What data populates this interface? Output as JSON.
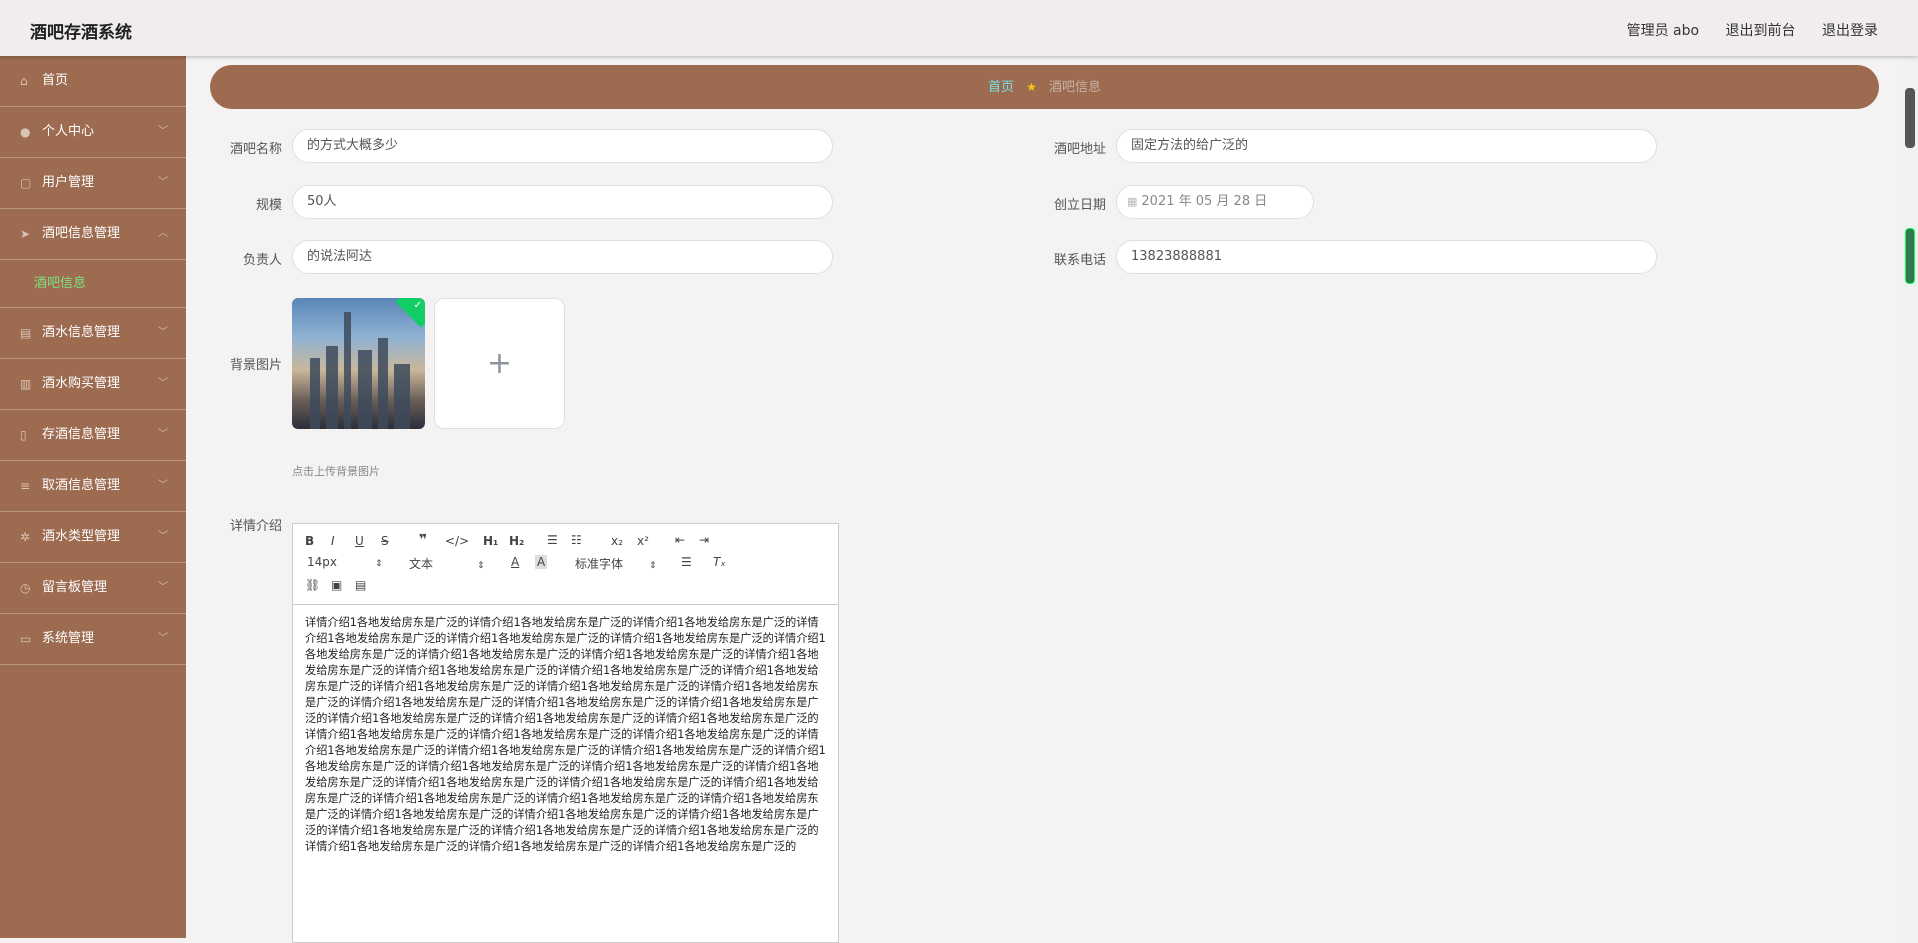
{
  "header": {
    "app_title": "酒吧存酒系统",
    "admin_label": "管理员 abo",
    "front_link": "退出到前台",
    "logout_link": "退出登录"
  },
  "sidebar": {
    "items": [
      {
        "label": "首页",
        "icon": "home-icon"
      },
      {
        "label": "个人中心",
        "icon": "user-icon"
      },
      {
        "label": "用户管理",
        "icon": "users-icon"
      },
      {
        "label": "酒吧信息管理",
        "icon": "location-icon",
        "sub": "酒吧信息"
      },
      {
        "label": "酒水信息管理",
        "icon": "drink-icon"
      },
      {
        "label": "酒水购买管理",
        "icon": "shop-icon"
      },
      {
        "label": "存酒信息管理",
        "icon": "bottle-icon"
      },
      {
        "label": "取酒信息管理",
        "icon": "sliders-icon"
      },
      {
        "label": "酒水类型管理",
        "icon": "category-icon"
      },
      {
        "label": "留言板管理",
        "icon": "clock-icon"
      },
      {
        "label": "系统管理",
        "icon": "system-icon"
      }
    ]
  },
  "breadcrumb": {
    "home": "首页",
    "current": "酒吧信息"
  },
  "form": {
    "bar_name_label": "酒吧名称",
    "bar_name_value": "的方式大概多少",
    "bar_address_label": "酒吧地址",
    "bar_address_value": "固定方法的给广泛的",
    "scale_label": "规模",
    "scale_value": "50人",
    "founded_label": "创立日期",
    "founded_value": "2021 年 05 月 28 日",
    "manager_label": "负责人",
    "manager_value": "的说法阿达",
    "phone_label": "联系电话",
    "phone_value": "13823888881",
    "bg_label": "背景图片",
    "upload_tip": "点击上传背景图片",
    "detail_label": "详情介绍"
  },
  "editor": {
    "font_size": "14px",
    "text_style": "文本",
    "font_family": "标准字体",
    "content": "详情介绍1各地发给房东是广泛的详情介绍1各地发给房东是广泛的详情介绍1各地发给房东是广泛的详情介绍1各地发给房东是广泛的详情介绍1各地发给房东是广泛的详情介绍1各地发给房东是广泛的详情介绍1各地发给房东是广泛的详情介绍1各地发给房东是广泛的详情介绍1各地发给房东是广泛的详情介绍1各地发给房东是广泛的详情介绍1各地发给房东是广泛的详情介绍1各地发给房东是广泛的详情介绍1各地发给房东是广泛的详情介绍1各地发给房东是广泛的详情介绍1各地发给房东是广泛的详情介绍1各地发给房东是广泛的详情介绍1各地发给房东是广泛的详情介绍1各地发给房东是广泛的详情介绍1各地发给房东是广泛的详情介绍1各地发给房东是广泛的详情介绍1各地发给房东是广泛的详情介绍1各地发给房东是广泛的详情介绍1各地发给房东是广泛的详情介绍1各地发给房东是广泛的详情介绍1各地发给房东是广泛的详情介绍1各地发给房东是广泛的详情介绍1各地发给房东是广泛的详情介绍1各地发给房东是广泛的详情介绍1各地发给房东是广泛的详情介绍1各地发给房东是广泛的详情介绍1各地发给房东是广泛的详情介绍1各地发给房东是广泛的详情介绍1各地发给房东是广泛的详情介绍1各地发给房东是广泛的详情介绍1各地发给房东是广泛的详情介绍1各地发给房东是广泛的详情介绍1各地发给房东是广泛的详情介绍1各地发给房东是广泛的详情介绍1各地发给房东是广泛的详情介绍1各地发给房东是广泛的详情介绍1各地发给房东是广泛的详情介绍1各地发给房东是广泛的详情介绍1各地发给房东是广泛的详情介绍1各地发给房东是广泛的详情介绍1各地发给房东是广泛的详情介绍1各地发给房东是广泛的详情介绍1各地发给房东是广泛的"
  },
  "colors": {
    "sidebar_bg": "#9d6b50",
    "active_sub": "#7ee07e",
    "breadcrumb_home": "#6fe3e3",
    "upload_success": "#13ce66"
  }
}
